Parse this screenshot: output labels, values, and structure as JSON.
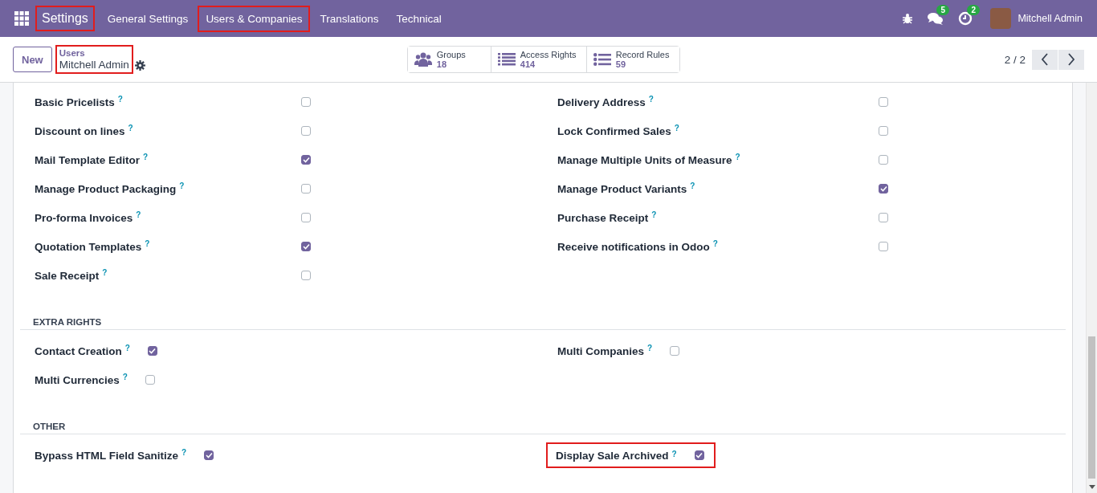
{
  "navbar": {
    "app": {
      "label": "Settings",
      "highlighted": true
    },
    "menu": [
      {
        "label": "General Settings",
        "highlighted": false
      },
      {
        "label": "Users & Companies",
        "highlighted": true
      },
      {
        "label": "Translations",
        "highlighted": false
      },
      {
        "label": "Technical",
        "highlighted": false
      }
    ],
    "messages_badge": "5",
    "activities_badge": "2",
    "user": "Mitchell Admin"
  },
  "control_panel": {
    "new_button": "New",
    "breadcrumb": {
      "parent": "Users",
      "current": "Mitchell Admin",
      "highlighted": true
    },
    "smart_buttons": [
      {
        "kind": "users",
        "label": "Groups",
        "count": "18"
      },
      {
        "kind": "list",
        "label": "Access Rights",
        "count": "414"
      },
      {
        "kind": "bullets",
        "label": "Record Rules",
        "count": "59"
      }
    ],
    "pager": "2 / 2"
  },
  "sections": [
    {
      "kind": "wide",
      "columns": [
        [
          {
            "label": "Basic Pricelists",
            "help": "?",
            "checked": false,
            "highlighted": false
          },
          {
            "label": "Discount on lines",
            "help": "?",
            "checked": false,
            "highlighted": false
          },
          {
            "label": "Mail Template Editor",
            "help": "?",
            "checked": true,
            "highlighted": false
          },
          {
            "label": "Manage Product Packaging",
            "help": "?",
            "checked": false,
            "highlighted": false
          },
          {
            "label": "Pro-forma Invoices",
            "help": "?",
            "checked": false,
            "highlighted": false
          },
          {
            "label": "Quotation Templates",
            "help": "?",
            "checked": true,
            "highlighted": false
          },
          {
            "label": "Sale Receipt",
            "help": "?",
            "checked": false,
            "highlighted": false
          }
        ],
        [
          {
            "label": "Delivery Address",
            "help": "?",
            "checked": false,
            "highlighted": false
          },
          {
            "label": "Lock Confirmed Sales",
            "help": "?",
            "checked": false,
            "highlighted": false
          },
          {
            "label": "Manage Multiple Units of Measure",
            "help": "?",
            "checked": false,
            "highlighted": false
          },
          {
            "label": "Manage Product Variants",
            "help": "?",
            "checked": true,
            "highlighted": false
          },
          {
            "label": "Purchase Receipt",
            "help": "?",
            "checked": false,
            "highlighted": false
          },
          {
            "label": "Receive notifications in Odoo",
            "help": "?",
            "checked": false,
            "highlighted": false
          }
        ]
      ]
    },
    {
      "kind": "compact",
      "title": "EXTRA RIGHTS",
      "columns": [
        [
          {
            "label": "Contact Creation",
            "help": "?",
            "checked": true,
            "highlighted": false
          },
          {
            "label": "Multi Currencies",
            "help": "?",
            "checked": false,
            "highlighted": false
          }
        ],
        [
          {
            "label": "Multi Companies",
            "help": "?",
            "checked": false,
            "highlighted": false
          }
        ]
      ]
    },
    {
      "kind": "compact",
      "title": "OTHER",
      "columns": [
        [
          {
            "label": "Bypass HTML Field Sanitize",
            "help": "?",
            "checked": true,
            "highlighted": false
          }
        ],
        [
          {
            "label": "Display Sale Archived",
            "help": "?",
            "checked": true,
            "highlighted": true
          }
        ]
      ]
    }
  ]
}
